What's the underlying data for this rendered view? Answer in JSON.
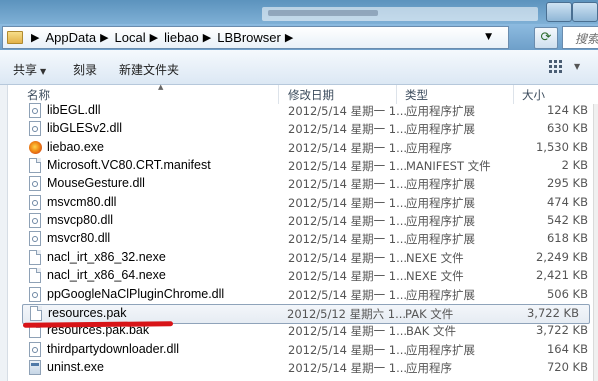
{
  "address": {
    "crumbs": [
      "AppData",
      "Local",
      "liebao",
      "LBBrowser"
    ],
    "search_placeholder": "搜索"
  },
  "toolbar": {
    "share_label": "共享",
    "burn_label": "刻录",
    "new_folder_label": "新建文件夹"
  },
  "columns": {
    "name": "名称",
    "date": "修改日期",
    "type": "类型",
    "size": "大小"
  },
  "files": [
    {
      "name": "libEGL.dll",
      "date": "2012/5/14 星期一 1...",
      "type": "应用程序扩展",
      "size": "124 KB",
      "icon": "dll-file-icon"
    },
    {
      "name": "libGLESv2.dll",
      "date": "2012/5/14 星期一 1...",
      "type": "应用程序扩展",
      "size": "630 KB",
      "icon": "dll-file-icon"
    },
    {
      "name": "liebao.exe",
      "date": "2012/5/14 星期一 1...",
      "type": "应用程序",
      "size": "1,530 KB",
      "icon": "liebao-app-icon"
    },
    {
      "name": "Microsoft.VC80.CRT.manifest",
      "date": "2012/5/14 星期一 1...",
      "type": "MANIFEST 文件",
      "size": "2 KB",
      "icon": "generic-file-icon"
    },
    {
      "name": "MouseGesture.dll",
      "date": "2012/5/14 星期一 1...",
      "type": "应用程序扩展",
      "size": "295 KB",
      "icon": "dll-file-icon"
    },
    {
      "name": "msvcm80.dll",
      "date": "2012/5/14 星期一 1...",
      "type": "应用程序扩展",
      "size": "474 KB",
      "icon": "dll-file-icon"
    },
    {
      "name": "msvcp80.dll",
      "date": "2012/5/14 星期一 1...",
      "type": "应用程序扩展",
      "size": "542 KB",
      "icon": "dll-file-icon"
    },
    {
      "name": "msvcr80.dll",
      "date": "2012/5/14 星期一 1...",
      "type": "应用程序扩展",
      "size": "618 KB",
      "icon": "dll-file-icon"
    },
    {
      "name": "nacl_irt_x86_32.nexe",
      "date": "2012/5/14 星期一 1...",
      "type": "NEXE 文件",
      "size": "2,249 KB",
      "icon": "generic-file-icon"
    },
    {
      "name": "nacl_irt_x86_64.nexe",
      "date": "2012/5/14 星期一 1...",
      "type": "NEXE 文件",
      "size": "2,421 KB",
      "icon": "generic-file-icon"
    },
    {
      "name": "ppGoogleNaClPluginChrome.dll",
      "date": "2012/5/14 星期一 1...",
      "type": "应用程序扩展",
      "size": "506 KB",
      "icon": "dll-file-icon"
    },
    {
      "name": "resources.pak",
      "date": "2012/5/12 星期六 1...",
      "type": "PAK 文件",
      "size": "3,722 KB",
      "icon": "generic-file-icon",
      "selected": true
    },
    {
      "name": "resources.pak.bak",
      "date": "2012/5/14 星期一 1...",
      "type": "BAK 文件",
      "size": "3,722 KB",
      "icon": "generic-file-icon"
    },
    {
      "name": "thirdpartydownloader.dll",
      "date": "2012/5/14 星期一 1...",
      "type": "应用程序扩展",
      "size": "164 KB",
      "icon": "dll-file-icon"
    },
    {
      "name": "uninst.exe",
      "date": "2012/5/14 星期一 1...",
      "type": "应用程序",
      "size": "720 KB",
      "icon": "app-exe-icon"
    }
  ],
  "colors": {
    "annotation_underline": "#d81418",
    "titlebar": "#5c93bd"
  }
}
